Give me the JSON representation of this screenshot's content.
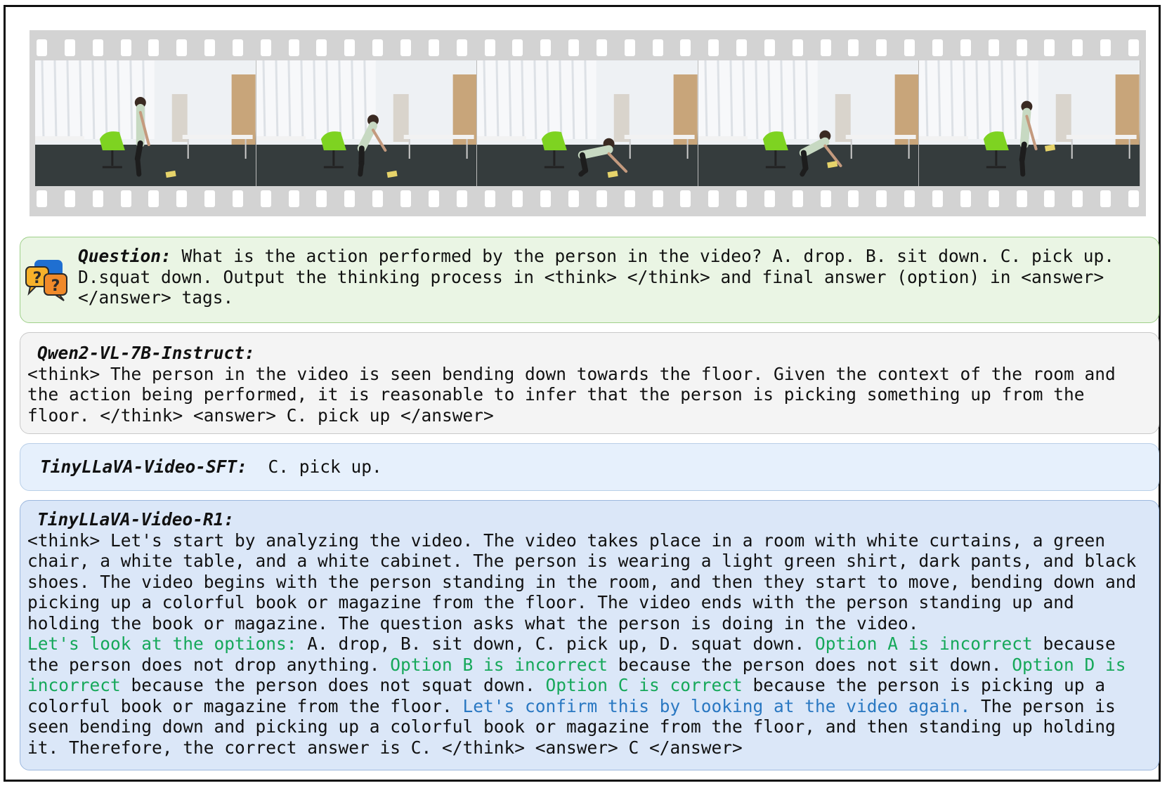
{
  "film_strip": {
    "frame_count": 5
  },
  "question": {
    "label": "Question:",
    "text": "What is the action performed by the person in the video? A. drop. B. sit down. C. pick up. D.squat down. Output the thinking process in <think> </think> and final answer (option) in <answer> </answer> tags."
  },
  "qwen": {
    "label": "Qwen2-VL-7B-Instruct:",
    "text": "<think> The person in the video is seen bending down towards the floor. Given the context of the room and the action being performed, it is reasonable to infer that the person is picking something up from the floor. </think> <answer> C. pick up </answer>"
  },
  "sft": {
    "label": "TinyLLaVA-Video-SFT:",
    "text": "C. pick up."
  },
  "r1": {
    "label": "TinyLLaVA-Video-R1:",
    "segments": [
      {
        "text": "<think> Let's start by analyzing the video. The video takes place in a room with white curtains, a green chair, a white table, and a white cabinet. The person is wearing a light green shirt, dark pants, and black shoes. The video begins with the person standing in the room, and then they start to move, bending down and picking up a colorful book or magazine from the floor. The video ends with the person standing up and holding the book or magazine. The question asks what the person is doing in the video."
      },
      {
        "text": "Let's look at the options:"
      },
      {
        "text": " A. drop, B. sit down, C. pick up, D. squat down. "
      },
      {
        "text": "Option A is incorrect"
      },
      {
        "text": " because the person does not drop anything. "
      },
      {
        "text": "Option B is incorrect"
      },
      {
        "text": " because the person does not sit down. "
      },
      {
        "text": "Option D is incorrect"
      },
      {
        "text": " because the person does not squat down. "
      },
      {
        "text": "Option C is correct"
      },
      {
        "text": " because the person is picking up a colorful book or magazine from the floor. "
      },
      {
        "text": "Let's confirm this by looking at the video again."
      },
      {
        "text": " The person is seen bending down and picking up a colorful book or magazine from the floor, and then standing up holding it. Therefore, the correct answer is C. </think> <answer> C </answer>"
      }
    ]
  },
  "colors": {
    "highlight_green": "#16a85a",
    "highlight_blue": "#2a78c2"
  }
}
